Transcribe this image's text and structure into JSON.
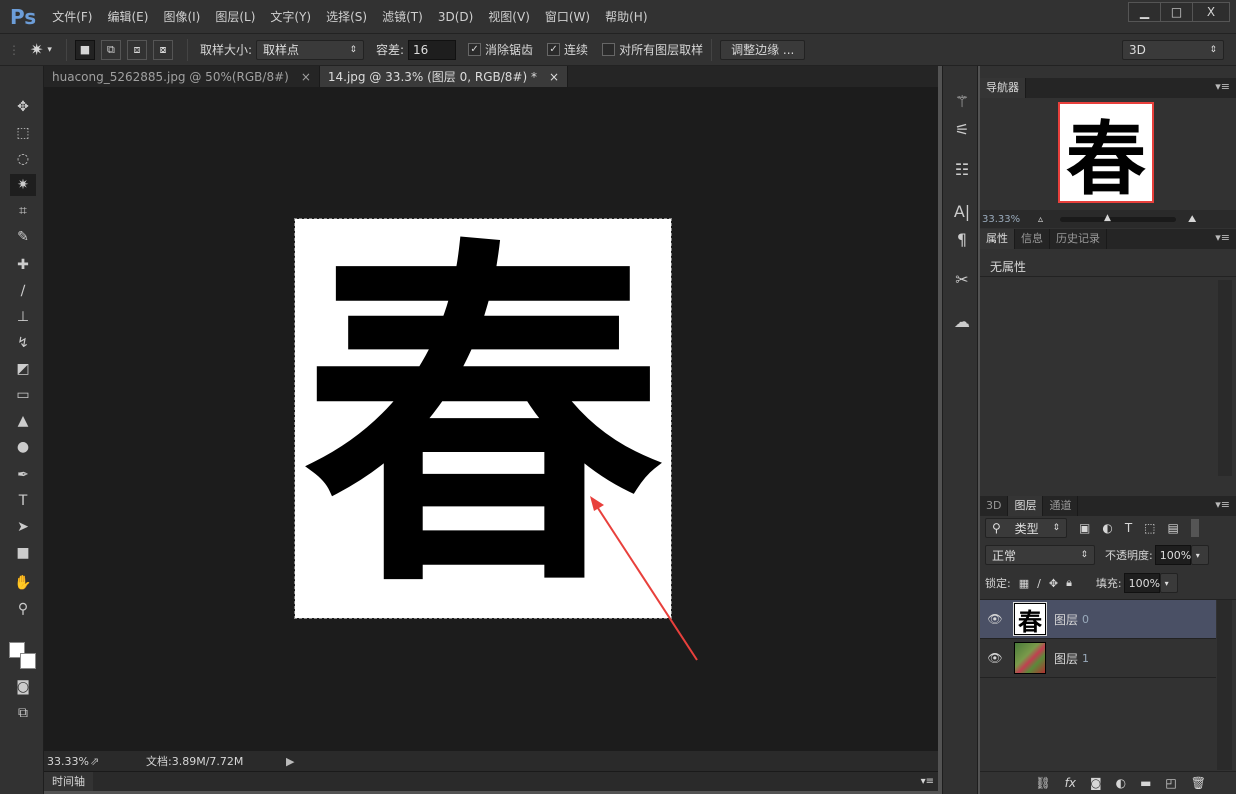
{
  "app": {
    "logo": "Ps"
  },
  "menu": [
    "文件(F)",
    "编辑(E)",
    "图像(I)",
    "图层(L)",
    "文字(Y)",
    "选择(S)",
    "滤镜(T)",
    "3D(D)",
    "视图(V)",
    "窗口(W)",
    "帮助(H)"
  ],
  "window_controls": {
    "minimize": "▁",
    "maximize": "□",
    "close": "X"
  },
  "options": {
    "sample_size_label": "取样大小:",
    "sample_size_value": "取样点",
    "tolerance_label": "容差:",
    "tolerance_value": "16",
    "antialias_label": "消除锯齿",
    "antialias_checked": true,
    "contiguous_label": "连续",
    "contiguous_checked": true,
    "sample_all_label": "对所有图层取样",
    "sample_all_checked": false,
    "refine_edge": "调整边缘 ...",
    "workspace": "3D"
  },
  "doc_tabs": [
    {
      "label": "huacong_5262885.jpg @ 50%(RGB/8#)",
      "active": false
    },
    {
      "label": "14.jpg @ 33.3% (图层 0, RGB/8#) *",
      "active": true
    }
  ],
  "canvas": {
    "glyph": "春"
  },
  "status": {
    "zoom": "33.33%",
    "doc_info": "文档:3.89M/7.72M"
  },
  "timeline": {
    "label": "时间轴"
  },
  "navigator": {
    "tab": "导航器",
    "zoom": "33.33%",
    "glyph": "春"
  },
  "properties": {
    "tabs": [
      "属性",
      "信息",
      "历史记录"
    ],
    "content": "无属性"
  },
  "layers_panel": {
    "tabs": [
      "3D",
      "图层",
      "通道"
    ],
    "filter": "类型",
    "blend_mode": "正常",
    "opacity_label": "不透明度:",
    "opacity": "100%",
    "lock_label": "锁定:",
    "fill_label": "填充:",
    "fill": "100%",
    "layers": [
      {
        "name": "图层",
        "index": "0",
        "selected": true,
        "thumb_glyph": "春"
      },
      {
        "name": "图层",
        "index": "1",
        "selected": false
      }
    ]
  },
  "colors": {
    "accent_red": "#e8403c",
    "selected_layer": "#4a5065"
  }
}
